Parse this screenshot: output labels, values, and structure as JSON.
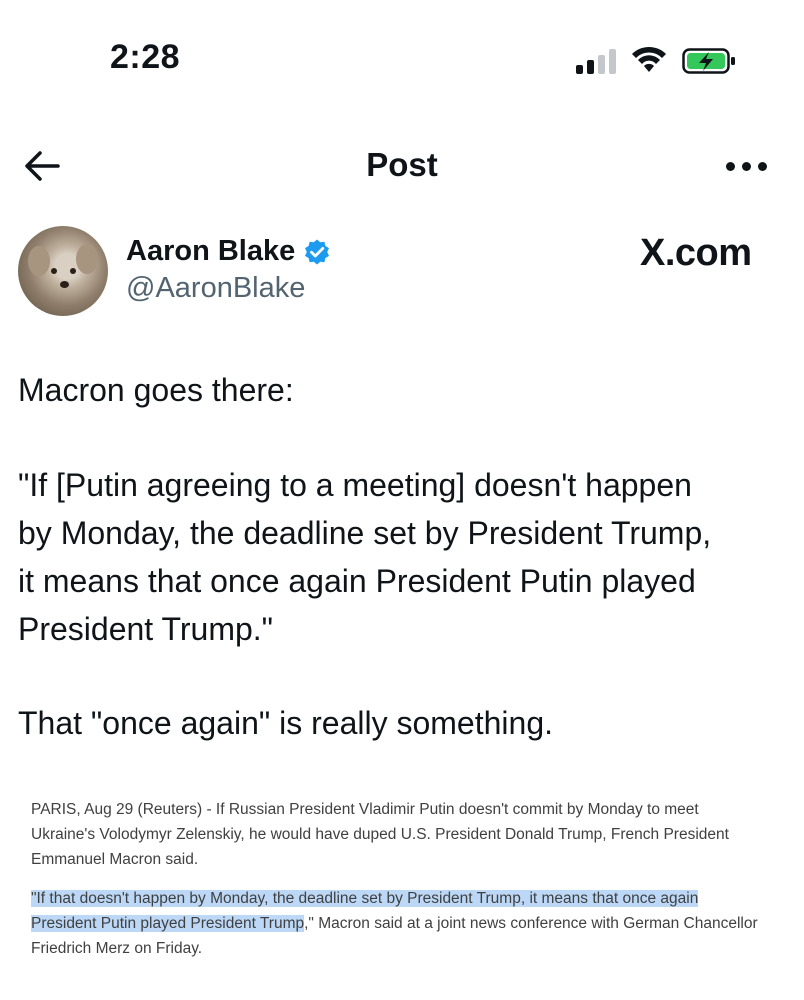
{
  "status_bar": {
    "time": "2:28",
    "colors": {
      "battery_fill": "#34c759",
      "signal_active": "#0f1419",
      "signal_inactive": "#c4c8cc"
    }
  },
  "nav": {
    "title": "Post",
    "back_icon": "arrow-left-icon",
    "more_icon": "more-horizontal-icon"
  },
  "author": {
    "name": "Aaron Blake",
    "handle": "@AaronBlake",
    "verified_icon": "verified-badge-icon",
    "verified_color": "#1d9bf0"
  },
  "site_mark": "X.com",
  "post": {
    "lines": [
      "Macron goes there:",
      "\"If [Putin agreeing to a meeting] doesn't happen",
      "by Monday, the deadline set by President Trump,",
      "it means that once again President Putin played",
      "President Trump.\"",
      "That \"once again\" is really something."
    ]
  },
  "article": {
    "p1_lines": [
      "PARIS, Aug 29 (Reuters) - If Russian President Vladimir Putin doesn't commit by Monday to meet",
      "Ukraine's Volodymyr Zelenskiy, he would have duped U.S. President Donald Trump, French President",
      "Emmanuel Macron said."
    ],
    "p2_line1_highlight": "\"If that doesn't happen by Monday, the deadline set by President Trump, it means that once again",
    "p2_line2_highlight": "President Putin played President Trump",
    "p2_line2_rest": ",\" Macron said at a joint news conference with German Chancellor",
    "p2_line3": "Friedrich Merz on Friday.",
    "highlight_color": "#bcd8f6"
  }
}
